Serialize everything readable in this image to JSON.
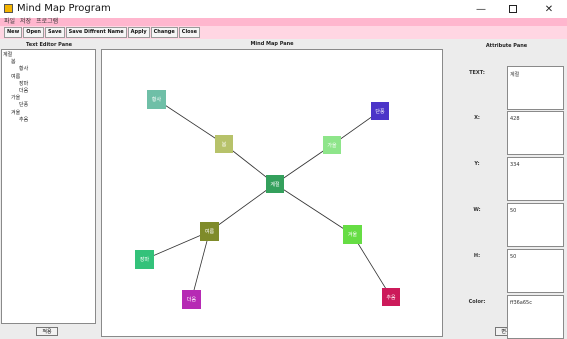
{
  "window": {
    "title": "Mind Map Program",
    "minimize_glyph": "—",
    "close_glyph": "✕"
  },
  "menubar": {
    "items": [
      "파일",
      "저장",
      "프로그램"
    ]
  },
  "toolbar": {
    "buttons": [
      "New",
      "Open",
      "Save",
      "Save Diffrent Name",
      "Apply",
      "Change",
      "Close"
    ]
  },
  "text_editor": {
    "title": "Text Editor Pane",
    "lines": [
      {
        "text": "계절",
        "indent": 0
      },
      {
        "text": "봄",
        "indent": 1
      },
      {
        "text": "황사",
        "indent": 2
      },
      {
        "text": "여름",
        "indent": 1
      },
      {
        "text": "장마",
        "indent": 2
      },
      {
        "text": "더움",
        "indent": 2
      },
      {
        "text": "가을",
        "indent": 1
      },
      {
        "text": "단풍",
        "indent": 2
      },
      {
        "text": "겨울",
        "indent": 1
      },
      {
        "text": "추움",
        "indent": 2
      }
    ],
    "apply_label": "적용"
  },
  "mind_map": {
    "title": "Mind Map Pane",
    "nodes": [
      {
        "id": "root",
        "text": "계절",
        "color": "#34a05c"
      },
      {
        "id": "spring",
        "text": "봄",
        "color": "#b7c26a"
      },
      {
        "id": "dust",
        "text": "황사",
        "color": "#6fbfa7"
      },
      {
        "id": "autumn",
        "text": "가을",
        "color": "#8ee58a"
      },
      {
        "id": "maple",
        "text": "단풍",
        "color": "#4b34c8"
      },
      {
        "id": "summer",
        "text": "여름",
        "color": "#7f8b2a"
      },
      {
        "id": "rain",
        "text": "장마",
        "color": "#33c27a"
      },
      {
        "id": "hot",
        "text": "더움",
        "color": "#b62ab4"
      },
      {
        "id": "winter",
        "text": "겨울",
        "color": "#66dd44"
      },
      {
        "id": "cold",
        "text": "추움",
        "color": "#cc1a5a"
      }
    ],
    "edges": [
      [
        "root",
        "spring"
      ],
      [
        "spring",
        "dust"
      ],
      [
        "root",
        "autumn"
      ],
      [
        "autumn",
        "maple"
      ],
      [
        "root",
        "summer"
      ],
      [
        "summer",
        "rain"
      ],
      [
        "summer",
        "hot"
      ],
      [
        "root",
        "winter"
      ],
      [
        "winter",
        "cold"
      ]
    ]
  },
  "attributes": {
    "title": "Attribute Pane",
    "fields": [
      {
        "label": "TEXT:",
        "value": "계절"
      },
      {
        "label": "X:",
        "value": "428"
      },
      {
        "label": "Y:",
        "value": "334"
      },
      {
        "label": "W:",
        "value": "50"
      },
      {
        "label": "H:",
        "value": "50"
      },
      {
        "label": "Color:",
        "value": "ff36a65c"
      }
    ],
    "change_label": "변경"
  }
}
